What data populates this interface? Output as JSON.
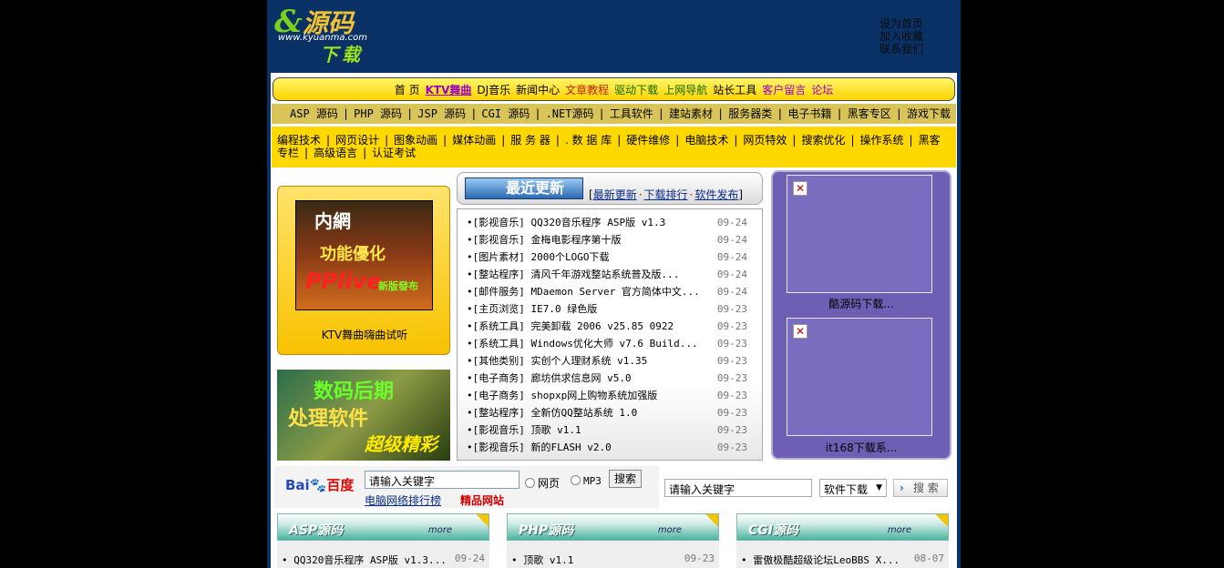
{
  "logo": {
    "brand": "源码",
    "url": "www.kyuanma.com",
    "sub": "下载"
  },
  "toplinks": [
    "设为首页",
    "加入收藏",
    "联系我们"
  ],
  "nav1": [
    {
      "label": "首 页",
      "color": "#000"
    },
    {
      "label": "KTV舞曲",
      "color": "#9a00c8"
    },
    {
      "label": "DJ音乐",
      "color": "#000"
    },
    {
      "label": "新闻中心",
      "color": "#000"
    },
    {
      "label": "文章教程",
      "color": "#c42000"
    },
    {
      "label": "驱动下载",
      "color": "#0f6b00"
    },
    {
      "label": "上网导航",
      "color": "#0f6b00"
    },
    {
      "label": "站长工具",
      "color": "#000"
    },
    {
      "label": "客户留言",
      "color": "#9a00c8"
    },
    {
      "label": "论坛",
      "color": "#9a00c8"
    }
  ],
  "nav2": [
    "ASP 源码",
    "PHP 源码",
    "JSP 源码",
    "CGI 源码",
    ".NET源码",
    "工具软件",
    "建站素材",
    "服务器类",
    "电子书籍",
    "黑客专区",
    "游戏下载"
  ],
  "nav3": [
    "编程技术",
    "网页设计",
    "图象动画",
    "媒体动画",
    "服 务 器",
    ". 数 据 库",
    "硬件维修",
    "电脑技术",
    "网页特效",
    "搜索优化",
    "操作系统",
    "黑客专栏",
    "高级语言",
    "认证考试"
  ],
  "promo": {
    "ktv_line1": "内網",
    "ktv_line2": "功能優化",
    "ktv_line3": "PPlive",
    "ktv_line4": "新版發布",
    "ktv_caption": "KTV舞曲嗨曲试听",
    "banner2_line1": "数码后期",
    "banner2_line2": "处理软件",
    "banner2_line3": "超级精彩"
  },
  "recent": {
    "tag": "最近更新",
    "links": [
      "最新更新",
      "下载排行",
      "软件发布"
    ],
    "items": [
      {
        "title": "•[影视音乐] QQ320音乐程序 ASP版 v1.3",
        "date": "09-24"
      },
      {
        "title": "•[影视音乐] 金梅电影程序第十版",
        "date": "09-24"
      },
      {
        "title": "•[图片素材] 2000个LOGO下载",
        "date": "09-24"
      },
      {
        "title": "•[整站程序] 清风千年游戏整站系统普及版...",
        "date": "09-24"
      },
      {
        "title": "•[邮件服务] MDaemon Server 官方简体中文...",
        "date": "09-24"
      },
      {
        "title": "•[主页浏览] IE7.0 绿色版",
        "date": "09-23"
      },
      {
        "title": "•[系统工具] 完美卸载 2006 v25.85 0922",
        "date": "09-23"
      },
      {
        "title": "•[系统工具] Windows优化大师 v7.6 Build...",
        "date": "09-23"
      },
      {
        "title": "•[其他类别] 实创个人理财系统 v1.35",
        "date": "09-23"
      },
      {
        "title": "•[电子商务] 廊坊供求信息网 v5.0",
        "date": "09-23"
      },
      {
        "title": "•[电子商务] shopxp网上购物系统加强版",
        "date": "09-23"
      },
      {
        "title": "•[整站程序] 全新仿QQ整站系统 1.0",
        "date": "09-23"
      },
      {
        "title": "•[影视音乐] 顶歌 v1.1",
        "date": "09-23"
      },
      {
        "title": "•[影视音乐] 新的FLASH v2.0",
        "date": "09-23"
      }
    ]
  },
  "right_ads": [
    "酷源码下载...",
    "it168下载系..."
  ],
  "search_left": {
    "brand_blue": "Bai",
    "brand_red": "百度",
    "placeholder": "请输入关键字",
    "opt_web": "网页",
    "opt_mp3": "MP3",
    "button": "搜索",
    "link_rank": "电脑网络排行榜",
    "link_best": "精品网站"
  },
  "search_right": {
    "placeholder": "请输入关键字",
    "select": "软件下载",
    "button": "搜 索"
  },
  "sections": [
    {
      "title": "ASP源码",
      "more": "more",
      "item": "QQ320音乐程序 ASP版 v1.3...",
      "date": "09-24"
    },
    {
      "title": "PHP源码",
      "more": "more",
      "item": "顶歌 v1.1",
      "date": "09-23"
    },
    {
      "title": "CGI源码",
      "more": "more",
      "item": "雷傲极酷超级论坛LeoBBS X...",
      "date": "08-07"
    }
  ]
}
